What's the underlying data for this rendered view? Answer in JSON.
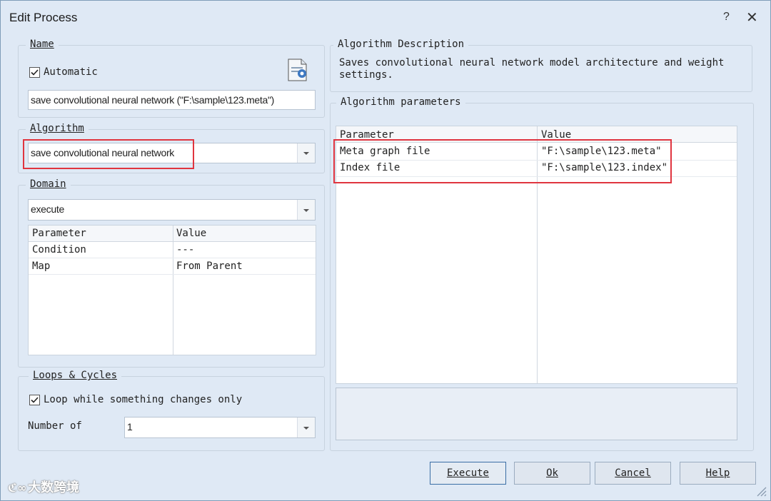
{
  "window": {
    "title": "Edit Process",
    "help_glyph": "?",
    "close_glyph": "✕"
  },
  "name_group": {
    "legend": "Name",
    "automatic_label": "Automatic",
    "automatic_checked": true,
    "name_value": "save convolutional neural network (\"F:\\sample\\123.meta\")",
    "icon": "document-settings-icon"
  },
  "algorithm_group": {
    "legend": "Algorithm",
    "selected": "save convolutional neural network"
  },
  "domain_group": {
    "legend": "Domain",
    "selected": "execute",
    "columns": [
      "Parameter",
      "Value"
    ],
    "rows": [
      {
        "parameter": "Condition",
        "value": "---"
      },
      {
        "parameter": "Map",
        "value": "From Parent"
      }
    ]
  },
  "loops_group": {
    "legend": "Loops & Cycles",
    "loop_label": "Loop while something changes only",
    "loop_checked": true,
    "number_label": "Number of",
    "number_value": "1"
  },
  "description_group": {
    "legend": "Algorithm Description",
    "text": "Saves convolutional neural network model architecture and weight settings."
  },
  "parameters_group": {
    "legend": "Algorithm parameters",
    "columns": [
      "Parameter",
      "Value"
    ],
    "rows": [
      {
        "parameter": "Meta graph file",
        "value": "\"F:\\sample\\123.meta\""
      },
      {
        "parameter": "Index file",
        "value": "\"F:\\sample\\123.index\""
      }
    ]
  },
  "buttons": {
    "execute": "Execute",
    "ok": "Ok",
    "cancel": "Cancel",
    "help": "Help"
  },
  "watermark": "大数跨境",
  "colors": {
    "background": "#dfe9f5",
    "highlight_red": "#e0353f",
    "default_button_border": "#3a6ea5"
  }
}
